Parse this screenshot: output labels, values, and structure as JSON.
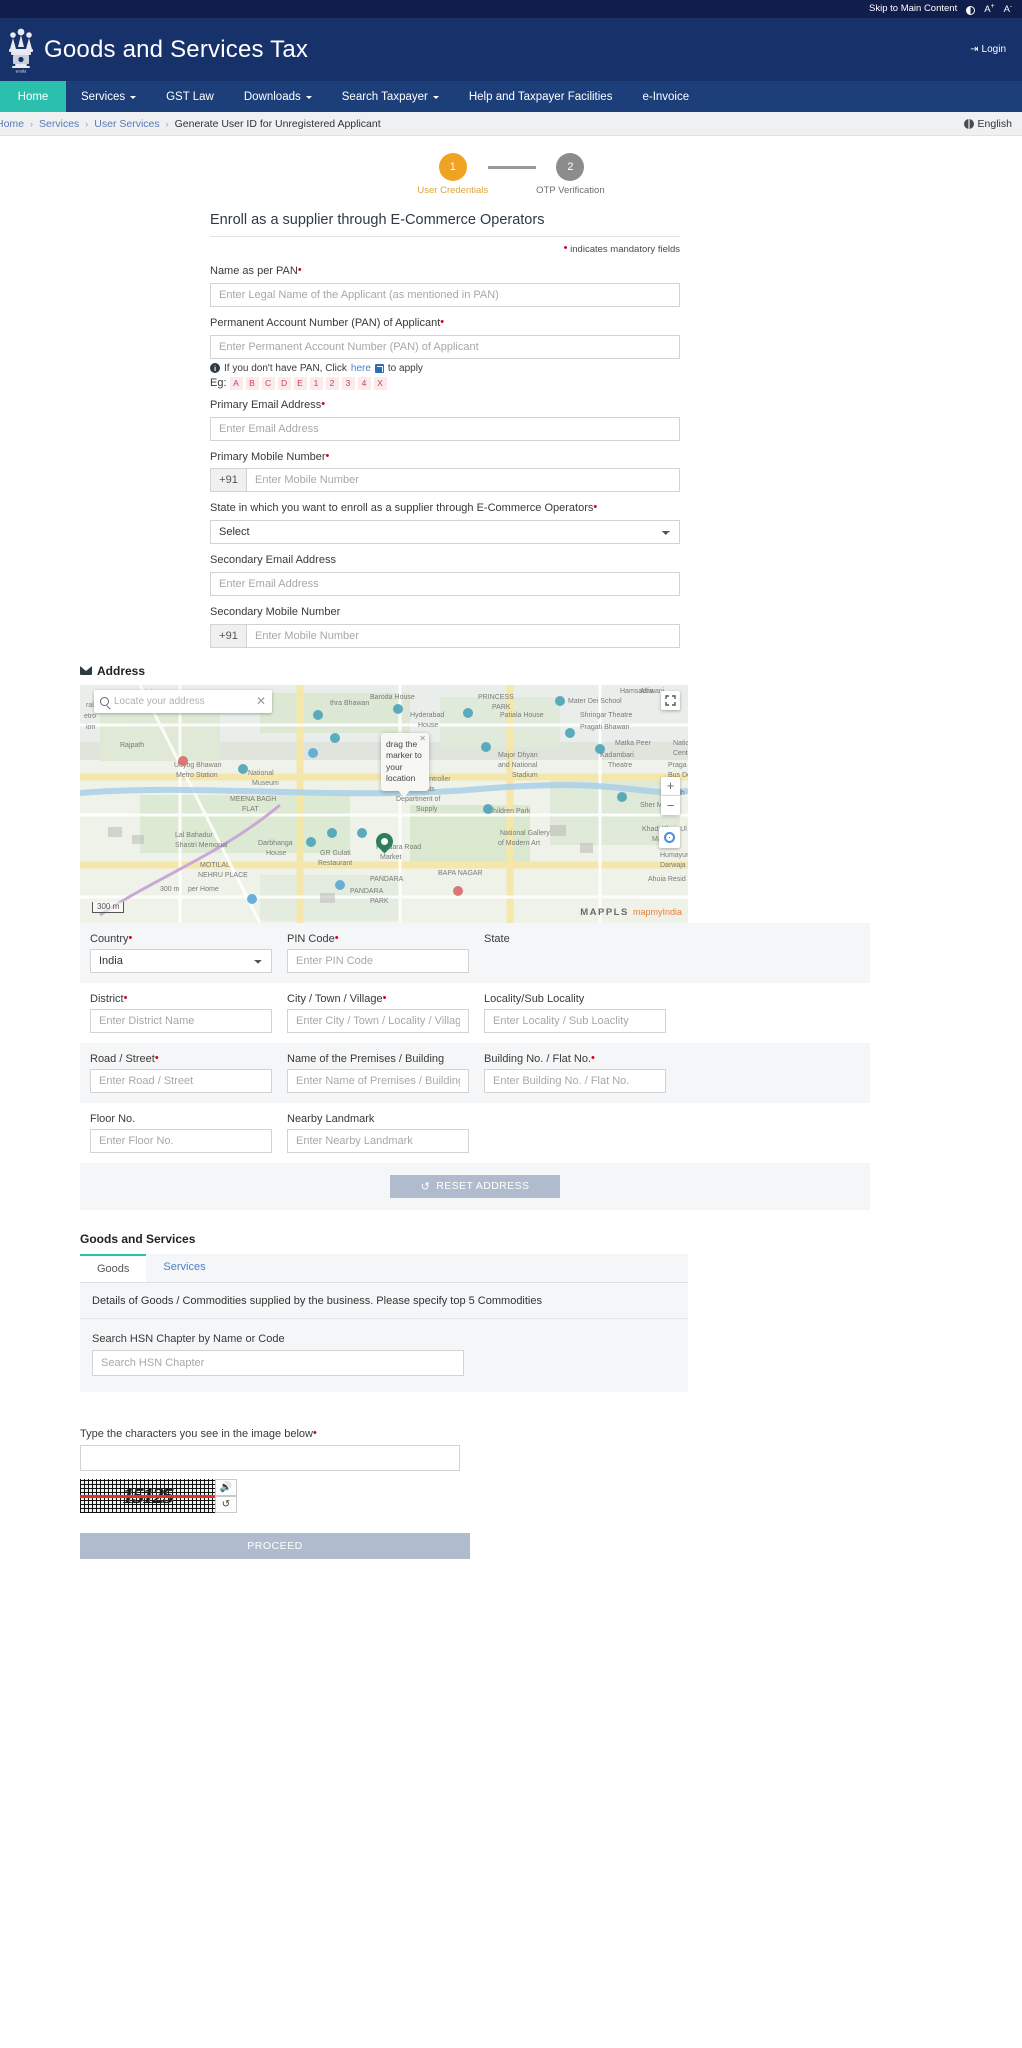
{
  "utilbar": {
    "skip": "Skip to Main Content",
    "contrast_icon": "contrast-icon",
    "font_large": "A",
    "font_large_sup": "+",
    "font_small": "A",
    "font_small_sup": "-"
  },
  "header": {
    "brand": "Goods and Services Tax",
    "emblem_icon": "india-emblem-icon",
    "login": "Login",
    "login_icon": "login-icon"
  },
  "nav": {
    "home": "Home",
    "items": [
      {
        "label": "Services",
        "caret": true
      },
      {
        "label": "GST Law",
        "caret": false
      },
      {
        "label": "Downloads",
        "caret": true
      },
      {
        "label": "Search Taxpayer",
        "caret": true
      },
      {
        "label": "Help and Taxpayer Facilities",
        "caret": false
      },
      {
        "label": "e-Invoice",
        "caret": false
      }
    ]
  },
  "breadcrumb": {
    "items": [
      "Home",
      "Services",
      "User Services"
    ],
    "current": "Generate User ID for Unregistered Applicant",
    "separator": "›",
    "language": "English",
    "globe_icon": "globe-icon"
  },
  "stepper": {
    "steps": [
      {
        "num": "1",
        "label": "User Credentials",
        "state": "active"
      },
      {
        "num": "2",
        "label": "OTP Verification",
        "state": "inactive"
      }
    ],
    "active_color": "#f0a320",
    "inactive_color": "#8c8c8c"
  },
  "form": {
    "title": "Enroll as a supplier through E-Commerce Operators",
    "mandatory_note": "indicates mandatory fields",
    "name_label": "Name as per PAN",
    "name_placeholder": "Enter Legal Name of the Applicant (as mentioned in PAN)",
    "pan_label": "Permanent Account Number (PAN) of Applicant",
    "pan_placeholder": "Enter Permanent Account Number (PAN) of Applicant",
    "pan_note_pre": "If you don't have PAN, Click",
    "pan_note_link": "here",
    "pan_note_post": "to apply",
    "eg_label": "Eg:",
    "eg_chars": [
      "A",
      "B",
      "C",
      "D",
      "E",
      "1",
      "2",
      "3",
      "4",
      "X"
    ],
    "email_label": "Primary Email Address",
    "email_placeholder": "Enter Email Address",
    "mobile_label": "Primary Mobile Number",
    "mobile_prefix": "+91",
    "mobile_placeholder": "Enter Mobile Number",
    "state_label": "State in which you want to enroll as a supplier through E-Commerce Operators",
    "state_selected": "Select",
    "state_options": [
      "Select"
    ],
    "sec_email_label": "Secondary Email Address",
    "sec_email_placeholder": "Enter Email Address",
    "sec_mobile_label": "Secondary Mobile Number",
    "sec_mobile_prefix": "+91",
    "sec_mobile_placeholder": "Enter Mobile Number"
  },
  "address": {
    "heading": "Address",
    "envelope_icon": "envelope-icon",
    "map": {
      "search_placeholder": "Locate your address",
      "search_icon": "search-icon",
      "clear_icon": "close-icon",
      "fullscreen_icon": "fullscreen-icon",
      "zoom_in": "+",
      "zoom_out": "−",
      "locate_icon": "my-location-icon",
      "marker_icon": "map-marker-icon",
      "tooltip": "drag the marker to your location",
      "scale": "300 m",
      "attribution": "MAPPLS",
      "attribution_sub": "mapmyIndia"
    },
    "rows": [
      [
        {
          "label": "Country",
          "required": true,
          "type": "select",
          "value": "India",
          "options": [
            "India"
          ]
        },
        {
          "label": "PIN Code",
          "required": true,
          "type": "text",
          "placeholder": "Enter PIN Code"
        },
        {
          "label": "State",
          "required": false,
          "type": "blank",
          "placeholder": ""
        }
      ],
      [
        {
          "label": "District",
          "required": true,
          "type": "text",
          "placeholder": "Enter District Name"
        },
        {
          "label": "City / Town / Village",
          "required": true,
          "type": "text",
          "placeholder": "Enter City / Town / Locality / Village"
        },
        {
          "label": "Locality/Sub Locality",
          "required": false,
          "type": "text",
          "placeholder": "Enter Locality / Sub Loaclity"
        }
      ],
      [
        {
          "label": "Road / Street",
          "required": true,
          "type": "text",
          "placeholder": "Enter Road / Street"
        },
        {
          "label": "Name of the Premises / Building",
          "required": false,
          "type": "text",
          "placeholder": "Enter Name of Premises / Building"
        },
        {
          "label": "Building No. / Flat No.",
          "required": true,
          "type": "text",
          "placeholder": "Enter Building No. / Flat No."
        }
      ],
      [
        {
          "label": "Floor No.",
          "required": false,
          "type": "text",
          "placeholder": "Enter Floor No."
        },
        {
          "label": "Nearby Landmark",
          "required": false,
          "type": "text",
          "placeholder": "Enter Nearby Landmark"
        }
      ]
    ],
    "reset_label": "RESET ADDRESS",
    "reset_icon": "refresh-icon"
  },
  "goods_services": {
    "title": "Goods and Services",
    "tabs": [
      {
        "label": "Goods",
        "active": true
      },
      {
        "label": "Services",
        "active": false
      }
    ],
    "description": "Details of Goods / Commodities supplied by the business. Please specify top 5 Commodities",
    "search_label": "Search HSN Chapter by Name or Code",
    "search_placeholder": "Search HSN Chapter"
  },
  "captcha": {
    "label": "Type the characters you see in the image below",
    "input_value": "",
    "image_text": "15125",
    "audio_icon": "speaker-icon",
    "refresh_icon": "refresh-icon"
  },
  "proceed": {
    "label": "PROCEED"
  }
}
